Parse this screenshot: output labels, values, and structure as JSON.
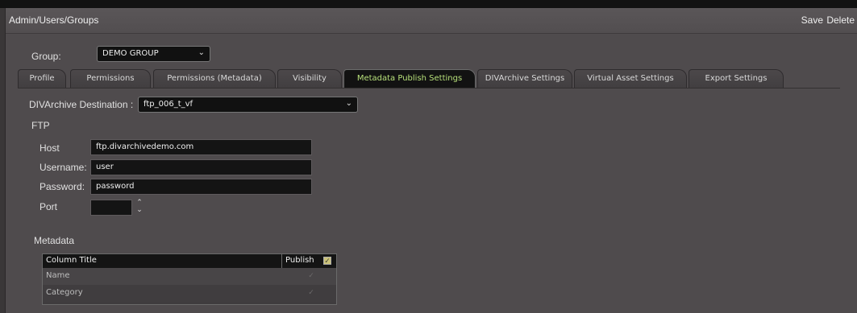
{
  "header": {
    "breadcrumb": "Admin/Users/Groups",
    "save_label": "Save",
    "delete_label": "Delete"
  },
  "group": {
    "label": "Group:",
    "selected": "DEMO GROUP"
  },
  "tabs": [
    {
      "label": "Profile"
    },
    {
      "label": "Permissions"
    },
    {
      "label": "Permissions (Metadata)"
    },
    {
      "label": "Visibility"
    },
    {
      "label": "Metadata Publish Settings"
    },
    {
      "label": "DIVArchive Settings"
    },
    {
      "label": "Virtual Asset Settings"
    },
    {
      "label": "Export Settings"
    }
  ],
  "active_tab": "Metadata Publish Settings",
  "destination": {
    "label": "DIVArchive Destination :",
    "selected": "ftp_006_t_vf"
  },
  "ftp": {
    "section_title": "FTP",
    "host_label": "Host",
    "host_value": "ftp.divarchivedemo.com",
    "username_label": "Username:",
    "username_value": "user",
    "password_label": "Password:",
    "password_value": "password",
    "port_label": "Port",
    "port_value": ""
  },
  "metadata": {
    "section_title": "Metadata",
    "columns": [
      "Column Title",
      "Publish"
    ],
    "rows": [
      {
        "title": "Name"
      },
      {
        "title": "Category"
      }
    ]
  },
  "colors": {
    "active_tab_text": "#b7e07a",
    "background": "#4f4b4d"
  }
}
